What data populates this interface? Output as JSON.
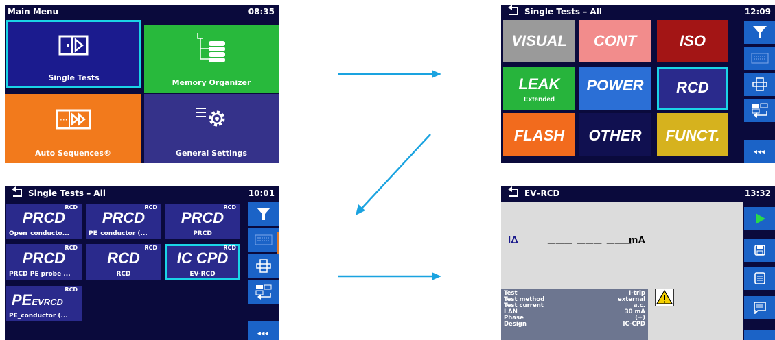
{
  "screens": {
    "main_menu": {
      "title": "Main Menu",
      "time": "08:35",
      "tiles": {
        "single_tests": "Single Tests",
        "memory_organizer": "Memory Organizer",
        "auto_sequences": "Auto Sequences®",
        "general_settings": "General Settings"
      }
    },
    "single_tests_top": {
      "title": "Single Tests – All",
      "time": "12:09",
      "tiles": {
        "visual": "VISUAL",
        "cont": "CONT",
        "iso": "ISO",
        "leak": "LEAK",
        "leak_sub": "Extended",
        "power": "POWER",
        "rcd": "RCD",
        "flash": "FLASH",
        "other": "OTHER",
        "funct": "FUNCT."
      },
      "more": "◂◂◂"
    },
    "single_tests_bottom": {
      "title": "Single Tests – All",
      "time": "10:01",
      "tiles": [
        {
          "corner": "RCD",
          "name": "PRCD",
          "sub": "Open_conducto..."
        },
        {
          "corner": "RCD",
          "name": "PRCD",
          "sub": "PE_conductor (..."
        },
        {
          "corner": "RCD",
          "name": "PRCD",
          "sub": "PRCD"
        },
        {
          "corner": "RCD",
          "name": "PRCD",
          "sub": "PRCD PE probe ..."
        },
        {
          "corner": "RCD",
          "name": "RCD",
          "sub": "RCD"
        },
        {
          "corner": "RCD",
          "name": "IC CPD",
          "sub": "EV-RCD"
        },
        {
          "corner": "RCD",
          "name": "PE",
          "name_sub": "EVRCD",
          "sub": "PE_conductor (..."
        }
      ],
      "more": "◂◂◂"
    },
    "ev_rcd": {
      "title": "EV–RCD",
      "time": "13:32",
      "measure_label": "IΔ",
      "measure_value": "___ ___ ___",
      "measure_unit": "mA",
      "params": [
        {
          "label": "Test",
          "value": "I-trip"
        },
        {
          "label": "Test method",
          "value": "external"
        },
        {
          "label": "Test current",
          "value": "a.c."
        },
        {
          "label": "I ΔN",
          "value": "30 mA"
        },
        {
          "label": "Phase",
          "value": "(+)"
        },
        {
          "label": "Design",
          "value": "IC-CPD"
        }
      ],
      "more": "◂◂◂"
    }
  },
  "colors": {
    "bg": "#0a0a3c",
    "selected_outline": "#1ad4e6",
    "arrow": "#1aa3e0",
    "side_button": "#1b63c7",
    "visual": "#9a9a9a",
    "cont": "#f28c8c",
    "iso": "#a31515",
    "leak": "#27b43c",
    "power": "#2b6fd6",
    "rcd": "#2a2a8c",
    "flash": "#f26b1d",
    "other": "#101050",
    "funct": "#d6b21e",
    "single_tests": "#1b1b8e",
    "memory_organizer": "#28b93c",
    "auto_sequences": "#f27a1c",
    "general_settings": "#35328a"
  },
  "icons": [
    "back-icon",
    "filter-icon",
    "keyboard-icon",
    "expand-icon",
    "recall-icon",
    "play-icon",
    "save-icon",
    "list-icon",
    "comment-icon",
    "warning-icon",
    "single-test-icon",
    "memory-tree-icon",
    "auto-sequence-icon",
    "settings-gear-icon"
  ]
}
